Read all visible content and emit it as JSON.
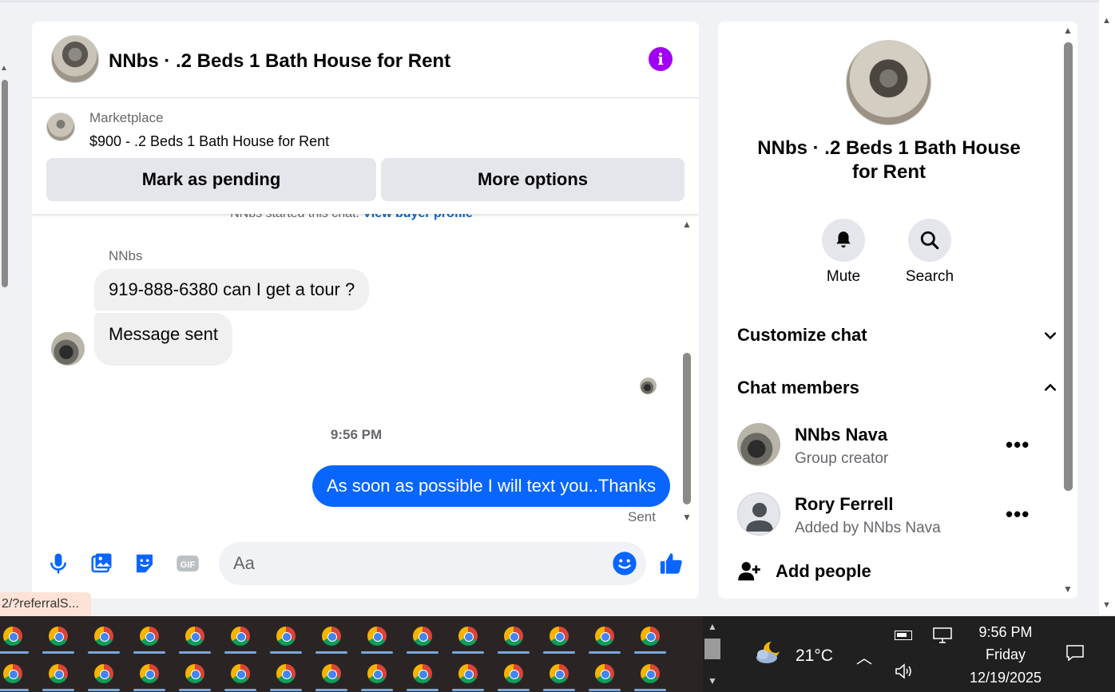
{
  "chat": {
    "title": "NNbs · .2 Beds 1 Bath House for Rent",
    "marketplace_label": "Marketplace",
    "listing": "$900 - .2 Beds 1 Bath House for Rent",
    "mark_pending_label": "Mark as pending",
    "more_options_label": "More options",
    "started_text": "NNbs started this chat. ",
    "view_buyer_profile": "View buyer profile",
    "sender_name": "NNbs",
    "messages_in": [
      "919-888-6380 can I get a tour ?",
      "Message sent"
    ],
    "time_separator": "9:56 PM",
    "message_out": "As soon as possible I will text you..Thanks",
    "sent_status": "Sent",
    "composer_placeholder": "Aa"
  },
  "info_panel": {
    "title": "NNbs · .2 Beds 1 Bath House for Rent",
    "mute_label": "Mute",
    "search_label": "Search",
    "customize_label": "Customize chat",
    "members_label": "Chat members",
    "members": [
      {
        "name": "NNbs Nava",
        "subtitle": "Group creator"
      },
      {
        "name": "Rory Ferrell",
        "subtitle": "Added by NNbs Nava"
      }
    ],
    "add_people_label": "Add people"
  },
  "status_url": "2/?referralS...",
  "taskbar": {
    "temperature": "21°C",
    "time": "9:56 PM",
    "day": "Friday",
    "date": "12/19/2025"
  },
  "colors": {
    "accent_blue": "#0866ff",
    "info_purple": "#a100f2"
  }
}
